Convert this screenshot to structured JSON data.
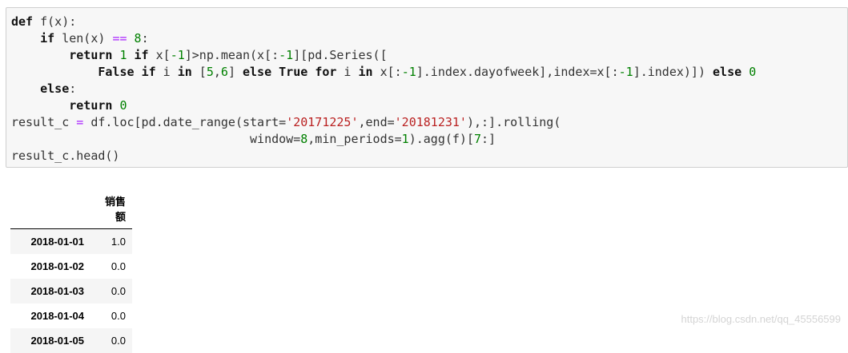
{
  "code_cell": {
    "lines": [
      {
        "segments": [
          {
            "t": "def",
            "c": "kw-dark"
          },
          {
            "t": " f(x):",
            "c": ""
          }
        ]
      },
      {
        "segments": [
          {
            "t": "    ",
            "c": ""
          },
          {
            "t": "if",
            "c": "kw-dark"
          },
          {
            "t": " len(x) ",
            "c": ""
          },
          {
            "t": "==",
            "c": "op"
          },
          {
            "t": " ",
            "c": ""
          },
          {
            "t": "8",
            "c": "num"
          },
          {
            "t": ":",
            "c": ""
          }
        ]
      },
      {
        "segments": [
          {
            "t": "        ",
            "c": ""
          },
          {
            "t": "return",
            "c": "kw-dark"
          },
          {
            "t": " ",
            "c": ""
          },
          {
            "t": "1",
            "c": "num"
          },
          {
            "t": " ",
            "c": ""
          },
          {
            "t": "if",
            "c": "kw-dark"
          },
          {
            "t": " x[",
            "c": ""
          },
          {
            "t": "-1",
            "c": "num"
          },
          {
            "t": "]>np.mean(x[:",
            "c": ""
          },
          {
            "t": "-1",
            "c": "num"
          },
          {
            "t": "][pd.Series([",
            "c": ""
          }
        ]
      },
      {
        "segments": [
          {
            "t": "            ",
            "c": ""
          },
          {
            "t": "False",
            "c": "kw-dark"
          },
          {
            "t": " ",
            "c": ""
          },
          {
            "t": "if",
            "c": "kw-dark"
          },
          {
            "t": " i ",
            "c": ""
          },
          {
            "t": "in",
            "c": "kw-dark"
          },
          {
            "t": " [",
            "c": ""
          },
          {
            "t": "5",
            "c": "num"
          },
          {
            "t": ",",
            "c": ""
          },
          {
            "t": "6",
            "c": "num"
          },
          {
            "t": "] ",
            "c": ""
          },
          {
            "t": "else",
            "c": "kw-dark"
          },
          {
            "t": " ",
            "c": ""
          },
          {
            "t": "True",
            "c": "kw-dark"
          },
          {
            "t": " ",
            "c": ""
          },
          {
            "t": "for",
            "c": "kw-dark"
          },
          {
            "t": " i ",
            "c": ""
          },
          {
            "t": "in",
            "c": "kw-dark"
          },
          {
            "t": " x[:",
            "c": ""
          },
          {
            "t": "-1",
            "c": "num"
          },
          {
            "t": "].index.dayofweek],index=x[:",
            "c": ""
          },
          {
            "t": "-1",
            "c": "num"
          },
          {
            "t": "].index)]) ",
            "c": ""
          },
          {
            "t": "else",
            "c": "kw-dark"
          },
          {
            "t": " ",
            "c": ""
          },
          {
            "t": "0",
            "c": "num"
          }
        ]
      },
      {
        "segments": [
          {
            "t": "    ",
            "c": ""
          },
          {
            "t": "else",
            "c": "kw-dark"
          },
          {
            "t": ":",
            "c": ""
          }
        ]
      },
      {
        "segments": [
          {
            "t": "        ",
            "c": ""
          },
          {
            "t": "return",
            "c": "kw-dark"
          },
          {
            "t": " ",
            "c": ""
          },
          {
            "t": "0",
            "c": "num"
          }
        ]
      },
      {
        "segments": [
          {
            "t": "result_c ",
            "c": ""
          },
          {
            "t": "=",
            "c": "op"
          },
          {
            "t": " df.loc[pd.date_range(start=",
            "c": ""
          },
          {
            "t": "'20171225'",
            "c": "str"
          },
          {
            "t": ",end=",
            "c": ""
          },
          {
            "t": "'20181231'",
            "c": "str"
          },
          {
            "t": "),:].rolling(",
            "c": ""
          }
        ]
      },
      {
        "segments": [
          {
            "t": "                                 window=",
            "c": ""
          },
          {
            "t": "8",
            "c": "num"
          },
          {
            "t": ",min_periods=",
            "c": ""
          },
          {
            "t": "1",
            "c": "num"
          },
          {
            "t": ").agg(f)[",
            "c": ""
          },
          {
            "t": "7",
            "c": "num"
          },
          {
            "t": ":]",
            "c": ""
          }
        ]
      },
      {
        "segments": [
          {
            "t": "result_c.head()",
            "c": ""
          }
        ]
      }
    ]
  },
  "output_table": {
    "column_header": "销售额",
    "rows": [
      {
        "index": "2018-01-01",
        "value": "1.0"
      },
      {
        "index": "2018-01-02",
        "value": "0.0"
      },
      {
        "index": "2018-01-03",
        "value": "0.0"
      },
      {
        "index": "2018-01-04",
        "value": "0.0"
      },
      {
        "index": "2018-01-05",
        "value": "0.0"
      }
    ]
  },
  "watermark": "https://blog.csdn.net/qq_45556599"
}
